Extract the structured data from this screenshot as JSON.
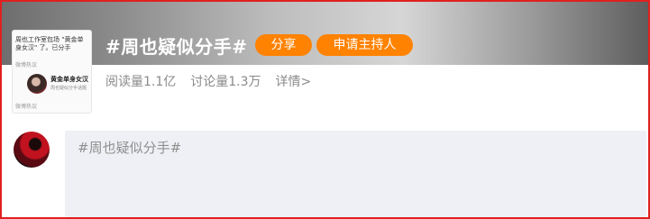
{
  "topic": {
    "title": "#周也疑似分手#",
    "share_label": "分享",
    "apply_host_label": "申请主持人"
  },
  "stats": {
    "read_count": "阅读量1.1亿",
    "discussion_count": "讨论量1.3万",
    "details_link": "详情>"
  },
  "thumbnail": {
    "snippet": "周也工作室包场 \"黄金单身女汉\" 了。已分手",
    "source_top": "微博热议",
    "account_name": "黄金单身女汉",
    "account_sub": "周也疑似分手话题",
    "source_bottom": "微博热议"
  },
  "composer": {
    "text": "#周也疑似分手#"
  },
  "colors": {
    "accent": "#ff8200",
    "frame": "#e02020",
    "composer_bg": "#eef0f5"
  }
}
